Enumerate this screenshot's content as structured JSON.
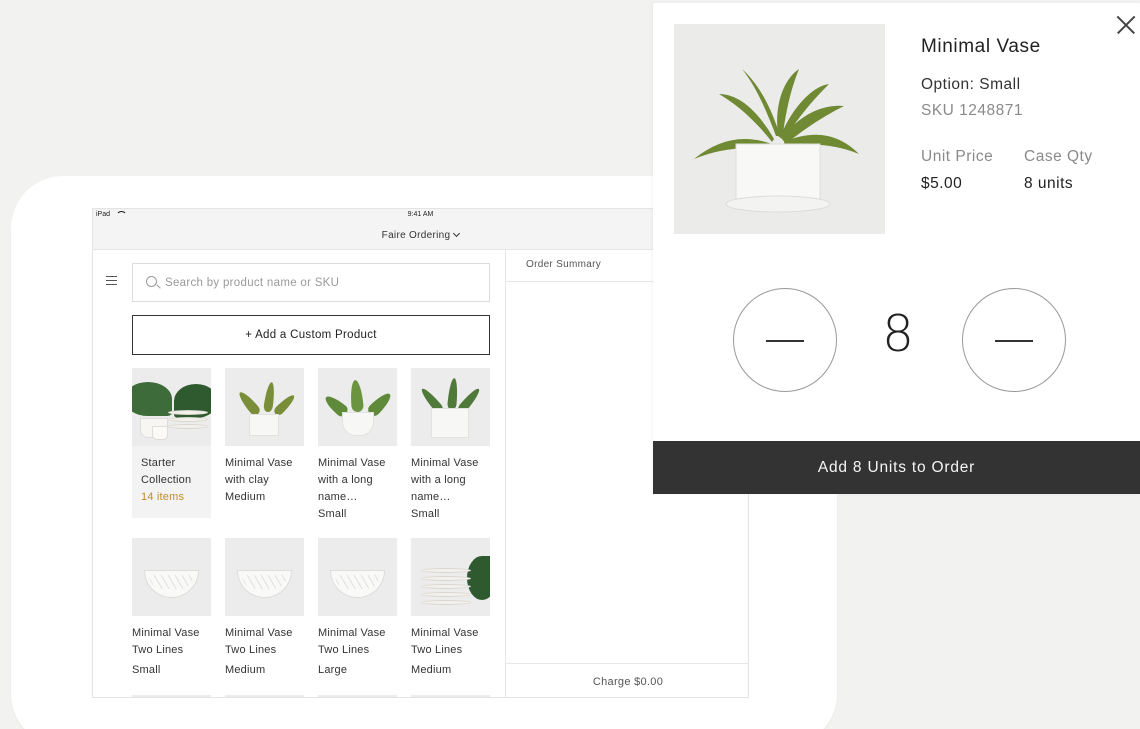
{
  "status_bar": {
    "device": "iPad",
    "time": "9:41 AM"
  },
  "nav": {
    "title": "Faire Ordering"
  },
  "search": {
    "placeholder": "Search by product name or SKU"
  },
  "add_custom_label": "+ Add a Custom Product",
  "products": [
    {
      "line1": "Starter",
      "line2": "Collection",
      "line3": "14 items",
      "line4": ""
    },
    {
      "line1": "Minimal Vase",
      "line2": "with clay",
      "line3": "Medium",
      "line4": ""
    },
    {
      "line1": "Minimal Vase",
      "line2": "with a long",
      "line3": "name…",
      "line4": "Small"
    },
    {
      "line1": "Minimal Vase",
      "line2": "with a long",
      "line3": "name…",
      "line4": "Small"
    },
    {
      "line1": "Minimal Vase",
      "line2": "Two Lines",
      "line3": "Small",
      "line4": ""
    },
    {
      "line1": "Minimal Vase",
      "line2": "Two Lines",
      "line3": "Medium",
      "line4": ""
    },
    {
      "line1": "Minimal Vase",
      "line2": "Two Lines",
      "line3": "Large",
      "line4": ""
    },
    {
      "line1": "Minimal Vase",
      "line2": "Two Lines",
      "line3": "Medium",
      "line4": ""
    }
  ],
  "order_summary": {
    "title": "Order Summary",
    "charge": "Charge $0.00"
  },
  "detail": {
    "title": "Minimal Vase",
    "option": "Option: Small",
    "sku": "SKU 1248871",
    "unit_price_label": "Unit Price",
    "unit_price": "$5.00",
    "case_qty_label": "Case Qty",
    "case_qty": "8 units",
    "quantity": "8",
    "cta": "Add 8 Units to Order"
  },
  "colors": {
    "accent_count": "#c28b2f",
    "cta_bg": "#333333",
    "background": "#f2f2f0"
  },
  "icons": [
    "wifi-icon",
    "menu-icon",
    "search-icon",
    "close-icon",
    "minus-icon",
    "plus-icon",
    "chevron-down-icon"
  ]
}
